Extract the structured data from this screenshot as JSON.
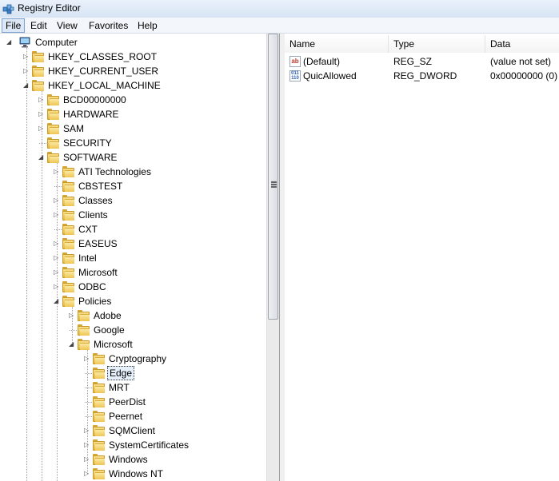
{
  "window": {
    "title": "Registry Editor"
  },
  "menu": [
    "File",
    "Edit",
    "View",
    "Favorites",
    "Help"
  ],
  "tree": [
    {
      "label": "Computer",
      "level": 0,
      "expander": "open",
      "icon": "computer-icon"
    },
    {
      "label": "HKEY_CLASSES_ROOT",
      "level": 1,
      "expander": "closed"
    },
    {
      "label": "HKEY_CURRENT_USER",
      "level": 1,
      "expander": "closed"
    },
    {
      "label": "HKEY_LOCAL_MACHINE",
      "level": 1,
      "expander": "open"
    },
    {
      "label": "BCD00000000",
      "level": 2,
      "expander": "closed"
    },
    {
      "label": "HARDWARE",
      "level": 2,
      "expander": "closed"
    },
    {
      "label": "SAM",
      "level": 2,
      "expander": "closed"
    },
    {
      "label": "SECURITY",
      "level": 2,
      "expander": "none"
    },
    {
      "label": "SOFTWARE",
      "level": 2,
      "expander": "open"
    },
    {
      "label": "ATI Technologies",
      "level": 3,
      "expander": "closed"
    },
    {
      "label": "CBSTEST",
      "level": 3,
      "expander": "none"
    },
    {
      "label": "Classes",
      "level": 3,
      "expander": "closed"
    },
    {
      "label": "Clients",
      "level": 3,
      "expander": "closed"
    },
    {
      "label": "CXT",
      "level": 3,
      "expander": "none"
    },
    {
      "label": "EASEUS",
      "level": 3,
      "expander": "closed"
    },
    {
      "label": "Intel",
      "level": 3,
      "expander": "closed"
    },
    {
      "label": "Microsoft",
      "level": 3,
      "expander": "closed"
    },
    {
      "label": "ODBC",
      "level": 3,
      "expander": "closed"
    },
    {
      "label": "Policies",
      "level": 3,
      "expander": "open"
    },
    {
      "label": "Adobe",
      "level": 4,
      "expander": "closed"
    },
    {
      "label": "Google",
      "level": 4,
      "expander": "none"
    },
    {
      "label": "Microsoft",
      "level": 4,
      "expander": "open"
    },
    {
      "label": "Cryptography",
      "level": 5,
      "expander": "closed"
    },
    {
      "label": "Edge",
      "level": 5,
      "expander": "none",
      "selected": true
    },
    {
      "label": "MRT",
      "level": 5,
      "expander": "none"
    },
    {
      "label": "PeerDist",
      "level": 5,
      "expander": "none"
    },
    {
      "label": "Peernet",
      "level": 5,
      "expander": "none"
    },
    {
      "label": "SQMClient",
      "level": 5,
      "expander": "closed"
    },
    {
      "label": "SystemCertificates",
      "level": 5,
      "expander": "closed"
    },
    {
      "label": "Windows",
      "level": 5,
      "expander": "closed"
    },
    {
      "label": "Windows NT",
      "level": 5,
      "expander": "closed"
    }
  ],
  "columns": {
    "name": "Name",
    "type": "Type",
    "data": "Data"
  },
  "values": [
    {
      "name": "(Default)",
      "type": "REG_SZ",
      "data": "(value not set)",
      "icon": "string-value-icon"
    },
    {
      "name": "QuicAllowed",
      "type": "REG_DWORD",
      "data": "0x00000000 (0)",
      "icon": "dword-value-icon"
    }
  ]
}
